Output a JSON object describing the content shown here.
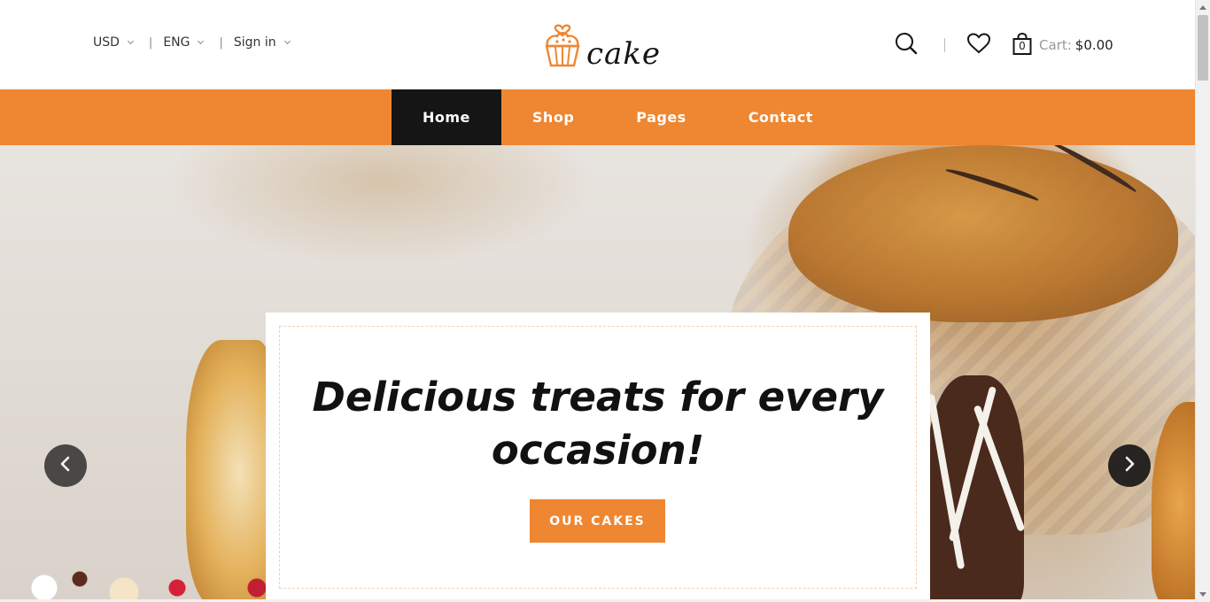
{
  "topbar": {
    "currency": "USD",
    "language": "ENG",
    "signin": "Sign in",
    "separator": "|"
  },
  "logo": {
    "text": "cake"
  },
  "cart": {
    "count": "0",
    "label": "Cart:",
    "amount": "$0.00"
  },
  "nav": {
    "items": [
      {
        "label": "Home",
        "active": true
      },
      {
        "label": "Shop",
        "active": false
      },
      {
        "label": "Pages",
        "active": false
      },
      {
        "label": "Contact",
        "active": false
      }
    ]
  },
  "hero": {
    "title": "Delicious treats for every occasion!",
    "button": "OUR CAKES"
  },
  "colors": {
    "accent": "#ef8632",
    "dark": "#151515",
    "white": "#ffffff"
  },
  "icons": {
    "search": "search-icon",
    "wishlist": "heart-icon",
    "cart": "shopping-bag-icon",
    "prev": "chevron-left-icon",
    "next": "chevron-right-icon",
    "logo": "cupcake-icon"
  }
}
